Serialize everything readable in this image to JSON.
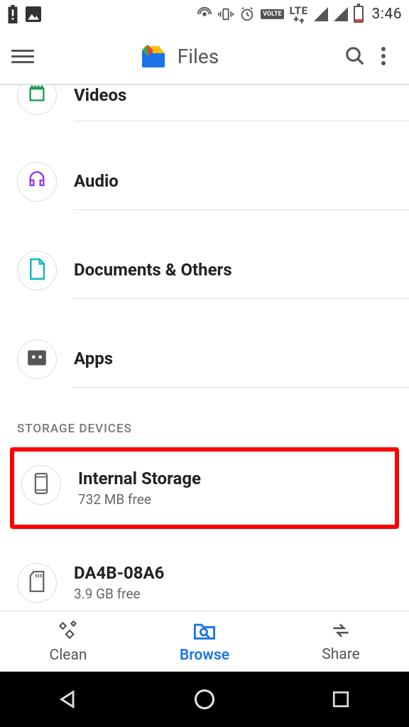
{
  "statusbar": {
    "time": "3:46",
    "lte": "LTE"
  },
  "appbar": {
    "title": "Files"
  },
  "categories": [
    {
      "label": "Videos"
    },
    {
      "label": "Audio"
    },
    {
      "label": "Documents & Others"
    },
    {
      "label": "Apps"
    }
  ],
  "section_header": "STORAGE DEVICES",
  "devices": [
    {
      "label": "Internal Storage",
      "sub": "732 MB free"
    },
    {
      "label": "DA4B-08A6",
      "sub": "3.9 GB free"
    }
  ],
  "bottom": {
    "clean": "Clean",
    "browse": "Browse",
    "share": "Share"
  }
}
